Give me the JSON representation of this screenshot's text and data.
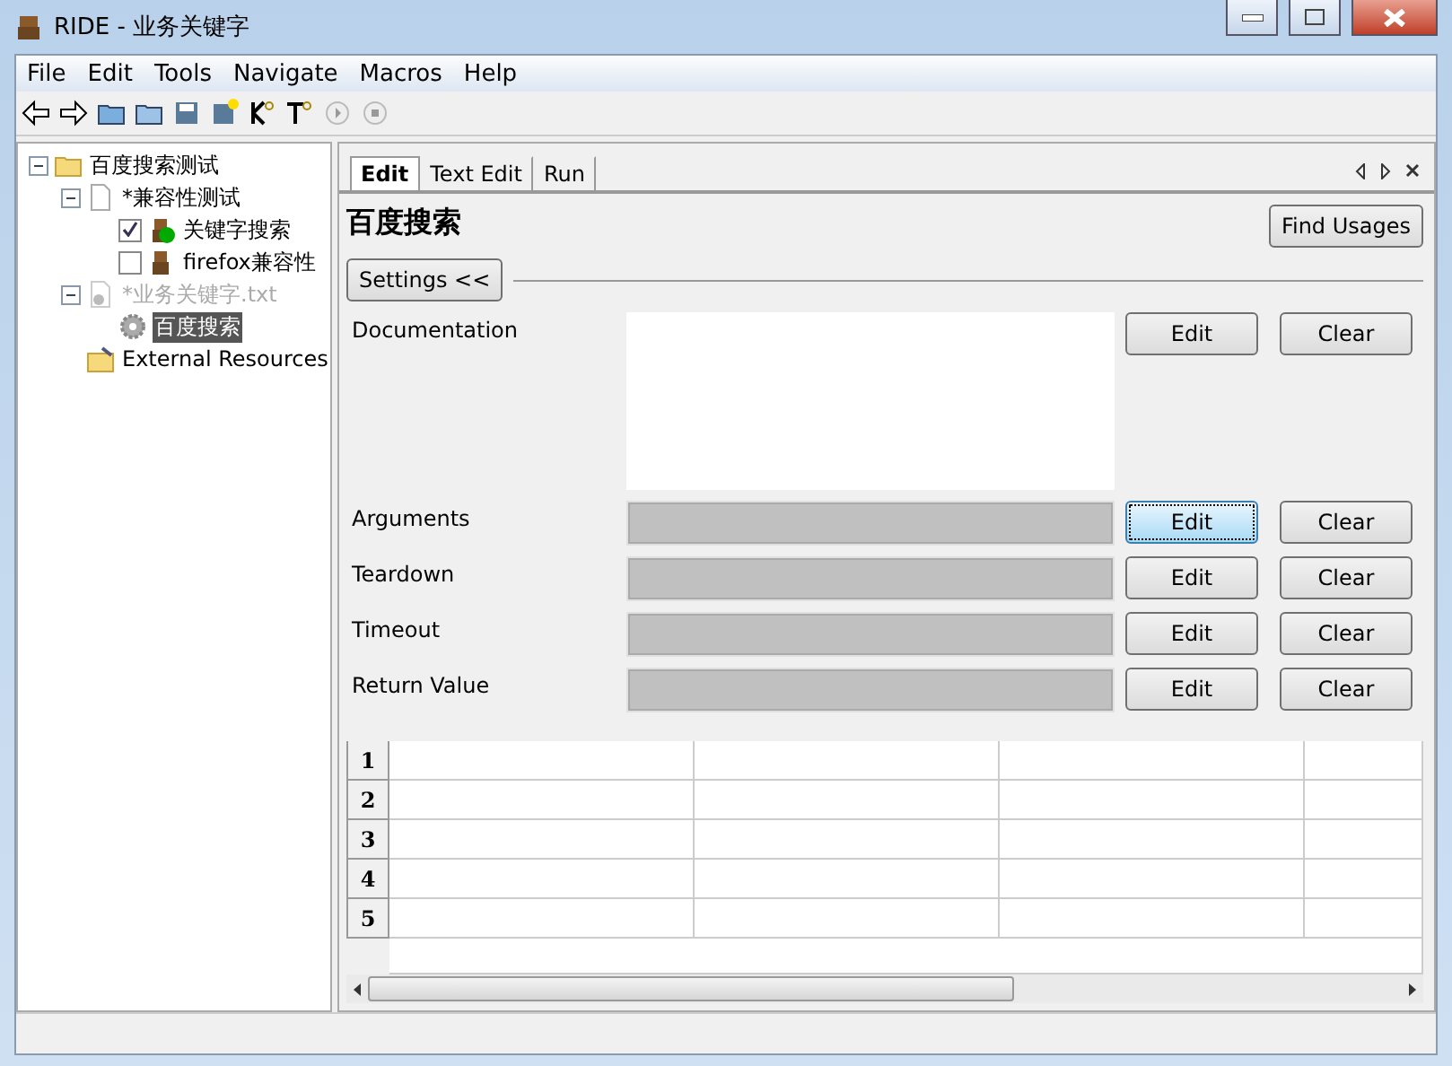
{
  "window": {
    "title": "RIDE - 业务关键字"
  },
  "menu": [
    "File",
    "Edit",
    "Tools",
    "Navigate",
    "Macros",
    "Help"
  ],
  "tree": [
    {
      "kind": "folder",
      "label": "百度搜索测试",
      "expanded": true,
      "children": [
        {
          "kind": "suite",
          "label": "*兼容性测试",
          "expanded": true,
          "children": [
            {
              "kind": "test",
              "label": "关键字搜索",
              "checked": true,
              "passed": true
            },
            {
              "kind": "test",
              "label": "firefox兼容性",
              "checked": false,
              "passed": false
            }
          ]
        },
        {
          "kind": "resource",
          "label": "*业务关键字.txt",
          "expanded": true,
          "disabled": true,
          "children": [
            {
              "kind": "keyword",
              "label": "百度搜索",
              "selected": true
            }
          ]
        },
        {
          "kind": "external",
          "label": "External Resources"
        }
      ]
    }
  ],
  "tabs": [
    {
      "label": "Edit",
      "selected": true
    },
    {
      "label": "Text Edit",
      "selected": false
    },
    {
      "label": "Run",
      "selected": false
    }
  ],
  "editor": {
    "title": "百度搜索",
    "find_usages": "Find Usages",
    "settings_toggle": "Settings <<",
    "settings": [
      {
        "kind": "doc",
        "label": "Documentation",
        "edit": "Edit",
        "clear": "Clear",
        "focused": false
      },
      {
        "kind": "field",
        "label": "Arguments",
        "edit": "Edit",
        "clear": "Clear",
        "focused": true
      },
      {
        "kind": "field",
        "label": "Teardown",
        "edit": "Edit",
        "clear": "Clear",
        "focused": false
      },
      {
        "kind": "field",
        "label": "Timeout",
        "edit": "Edit",
        "clear": "Clear",
        "focused": false
      },
      {
        "kind": "field",
        "label": "Return Value",
        "edit": "Edit",
        "clear": "Clear",
        "focused": false
      }
    ],
    "grid_rows": [
      "1",
      "2",
      "3",
      "4",
      "5"
    ]
  }
}
